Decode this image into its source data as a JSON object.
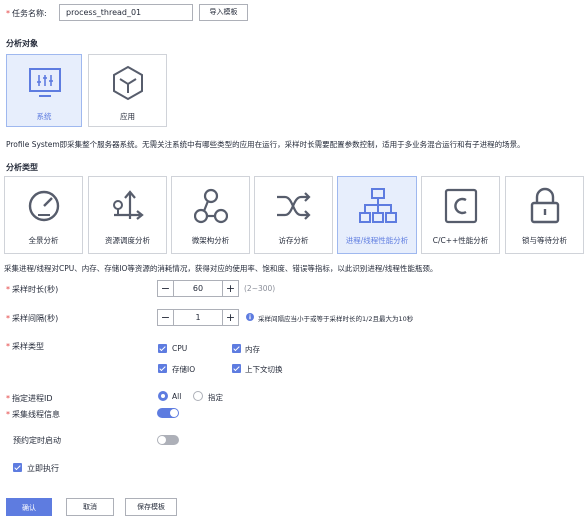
{
  "task": {
    "label": "任务名称:",
    "value": "process_thread_01",
    "import_button": "导入模板"
  },
  "analysis_target": {
    "title": "分析对象",
    "cards": [
      {
        "label": "系统",
        "icon": "monitor-icon",
        "selected": true
      },
      {
        "label": "应用",
        "icon": "cube-icon",
        "selected": false
      }
    ],
    "description": "Profile System即采集整个服务器系统。无需关注系统中有哪些类型的应用在运行，采样时长需要配置参数控制，适用于多业务混合运行和有子进程的场景。"
  },
  "analysis_type": {
    "title": "分析类型",
    "cards": [
      {
        "label": "全景分析",
        "icon": "gauge-icon",
        "selected": false
      },
      {
        "label": "资源调度分析",
        "icon": "schedule-icon",
        "selected": false
      },
      {
        "label": "微架构分析",
        "icon": "microarch-icon",
        "selected": false
      },
      {
        "label": "访存分析",
        "icon": "shuffle-icon",
        "selected": false
      },
      {
        "label": "进程/线程性能分析",
        "icon": "hierarchy-icon",
        "selected": true
      },
      {
        "label": "C/C++性能分析",
        "icon": "c-letter-icon",
        "selected": false
      },
      {
        "label": "锁与等待分析",
        "icon": "lock-icon",
        "selected": false
      }
    ],
    "description": "采集进程/线程对CPU、内存、存储IO等资源的消耗情况，获得对应的使用率、饱和度、错误等指标，以此识别进程/线程性能瓶颈。"
  },
  "form": {
    "duration": {
      "label": "采样时长(秒)",
      "value": "60",
      "range": "(2~300)"
    },
    "interval": {
      "label": "采样间隔(秒)",
      "value": "1",
      "hint": "采样间隔应当小于或等于采样时长的1/2且最大为10秒"
    },
    "sample_type": {
      "label": "采样类型",
      "options": [
        {
          "label": "CPU",
          "checked": true
        },
        {
          "label": "内存",
          "checked": true
        },
        {
          "label": "存储IO",
          "checked": true
        },
        {
          "label": "上下文切换",
          "checked": true
        }
      ]
    },
    "process_id": {
      "label": "指定进程ID",
      "option_all": "All",
      "option_specify": "指定",
      "selected": "All"
    },
    "thread_info": {
      "label": "采集线程信息",
      "enabled": true
    },
    "scheduled_start": {
      "label": "预约定时启动",
      "enabled": false
    },
    "run_now": {
      "label": "立即执行",
      "checked": true
    }
  },
  "footer": {
    "confirm": "确认",
    "cancel": "取消",
    "save_template": "保存模板"
  },
  "colors": {
    "accent": "#5e7ce0",
    "required": "#e54545",
    "icon": "#575d6c",
    "toggle_off": "#adb0b8"
  }
}
